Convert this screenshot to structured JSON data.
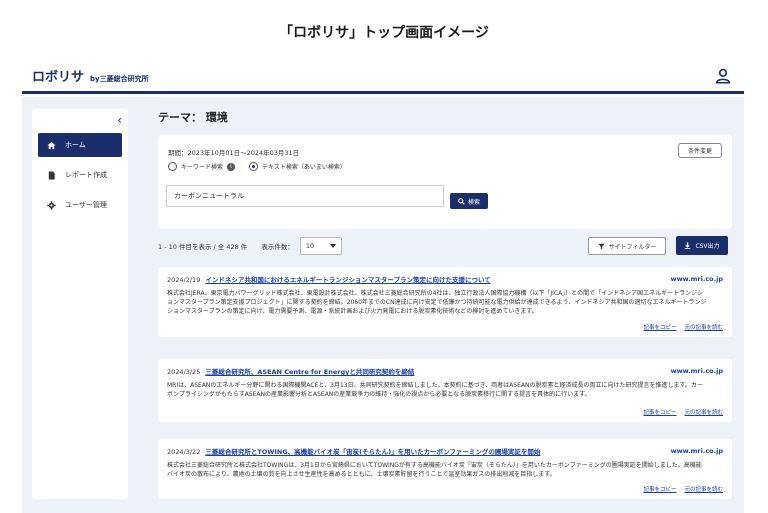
{
  "page": {
    "heading": "「ロボリサ」トップ画面イメージ"
  },
  "header": {
    "brand": "ロボリサ",
    "brand_sub": "by三菱総合研究所"
  },
  "sidebar": {
    "collapse_glyph": "‹",
    "items": [
      {
        "label": "ホーム",
        "icon": "home-icon",
        "active": true
      },
      {
        "label": "レポート作成",
        "icon": "document-icon",
        "active": false
      },
      {
        "label": "ユーザー管理",
        "icon": "gear-icon",
        "active": false
      }
    ]
  },
  "main": {
    "theme_title": "テーマ： 環境",
    "period": "期間：2023年10月01日〜2024年03月31日",
    "condition_button": "条件変更",
    "radio_keyword": "キーワード検索",
    "radio_keyword_info": "i",
    "radio_text": "テキスト検索（あいまい検索）",
    "search_value": "カーボンニュートラル",
    "search_button": "検索",
    "result_count": "1 - 10 件目を表示 / 全 428 件",
    "per_page_label": "表示件数：",
    "per_page_value": "10",
    "site_filter_button": "サイトフィルター",
    "csv_button": "CSV出力"
  },
  "results": [
    {
      "date": "2024/2/19",
      "title": "インドネシア共和国におけるエネルギートランジションマスタープラン策定に向けた支援について",
      "domain": "www.mri.co.jp",
      "body": "株式会社JERA、東京電力パワーグリッド株式会社、東電設計株式会社、株式会社三菱総合研究所の4社は、独立行政法人国際協力機構（以下「JICA」）との間で「インドネシア国エネルギートランジションマスタープラン策定支援プロジェクト」に関する契約を締結。2060年までのCN達成に向け安定で低廉かつ持続可能な電力供給が達成できるよう、インドネシア共和国の適切なエネルギートランジションマスタープランの策定に向け、電力需要予測、電源・系統計画および火力発電における脱炭素化技術などの検討を進めていきます。",
      "copy_link": "記事をコピー",
      "source_link": "元の記事を読む"
    },
    {
      "date": "2024/3/25",
      "title": "三菱総合研究所、ASEAN Centre for Energyと共同研究契約を締結",
      "domain": "www.mri.co.jp",
      "body": "MRIは、ASEANのエネルギー分野に関わる国際機関ACEと、3月13日、共同研究契約を締結しました。本契約に基づき、両者はASEANの脱炭素と経済成長の両立に向けた研究提言を推進します。カーボンプライシングがもたらすASEANの産業影響分析とASEANの産業競争力の維持・強化の視点から必要となる脱炭素移行に関する提言を具体的に行います。",
      "copy_link": "記事をコピー",
      "source_link": "元の記事を読む"
    },
    {
      "date": "2024/3/22",
      "title": "三菱総合研究所とTOWING、高機能バイオ炭「宙炭(そらたん)」を用いたカーボンファーミングの圃場実証を開始",
      "domain": "www.mri.co.jp",
      "body": "株式会社三菱総合研究所と株式会社TOWINGは、3月1日から宮崎県においてTOWINGが有する高機能バイオ炭「宙炭（そらたん）」を用いたカーボンファーミングの圃場実証を開始しました。高機能バイオ炭の散布により、農地の土壌の質を向上させ生産性を高めるとともに、土壌炭素貯留を行うことで温室効果ガスの排出削減を目指します。",
      "copy_link": "記事をコピー",
      "source_link": "元の記事を読む"
    }
  ],
  "colors": {
    "primary": "#1a2e6b",
    "link": "#1a3ea8",
    "background": "#eef2f8"
  }
}
